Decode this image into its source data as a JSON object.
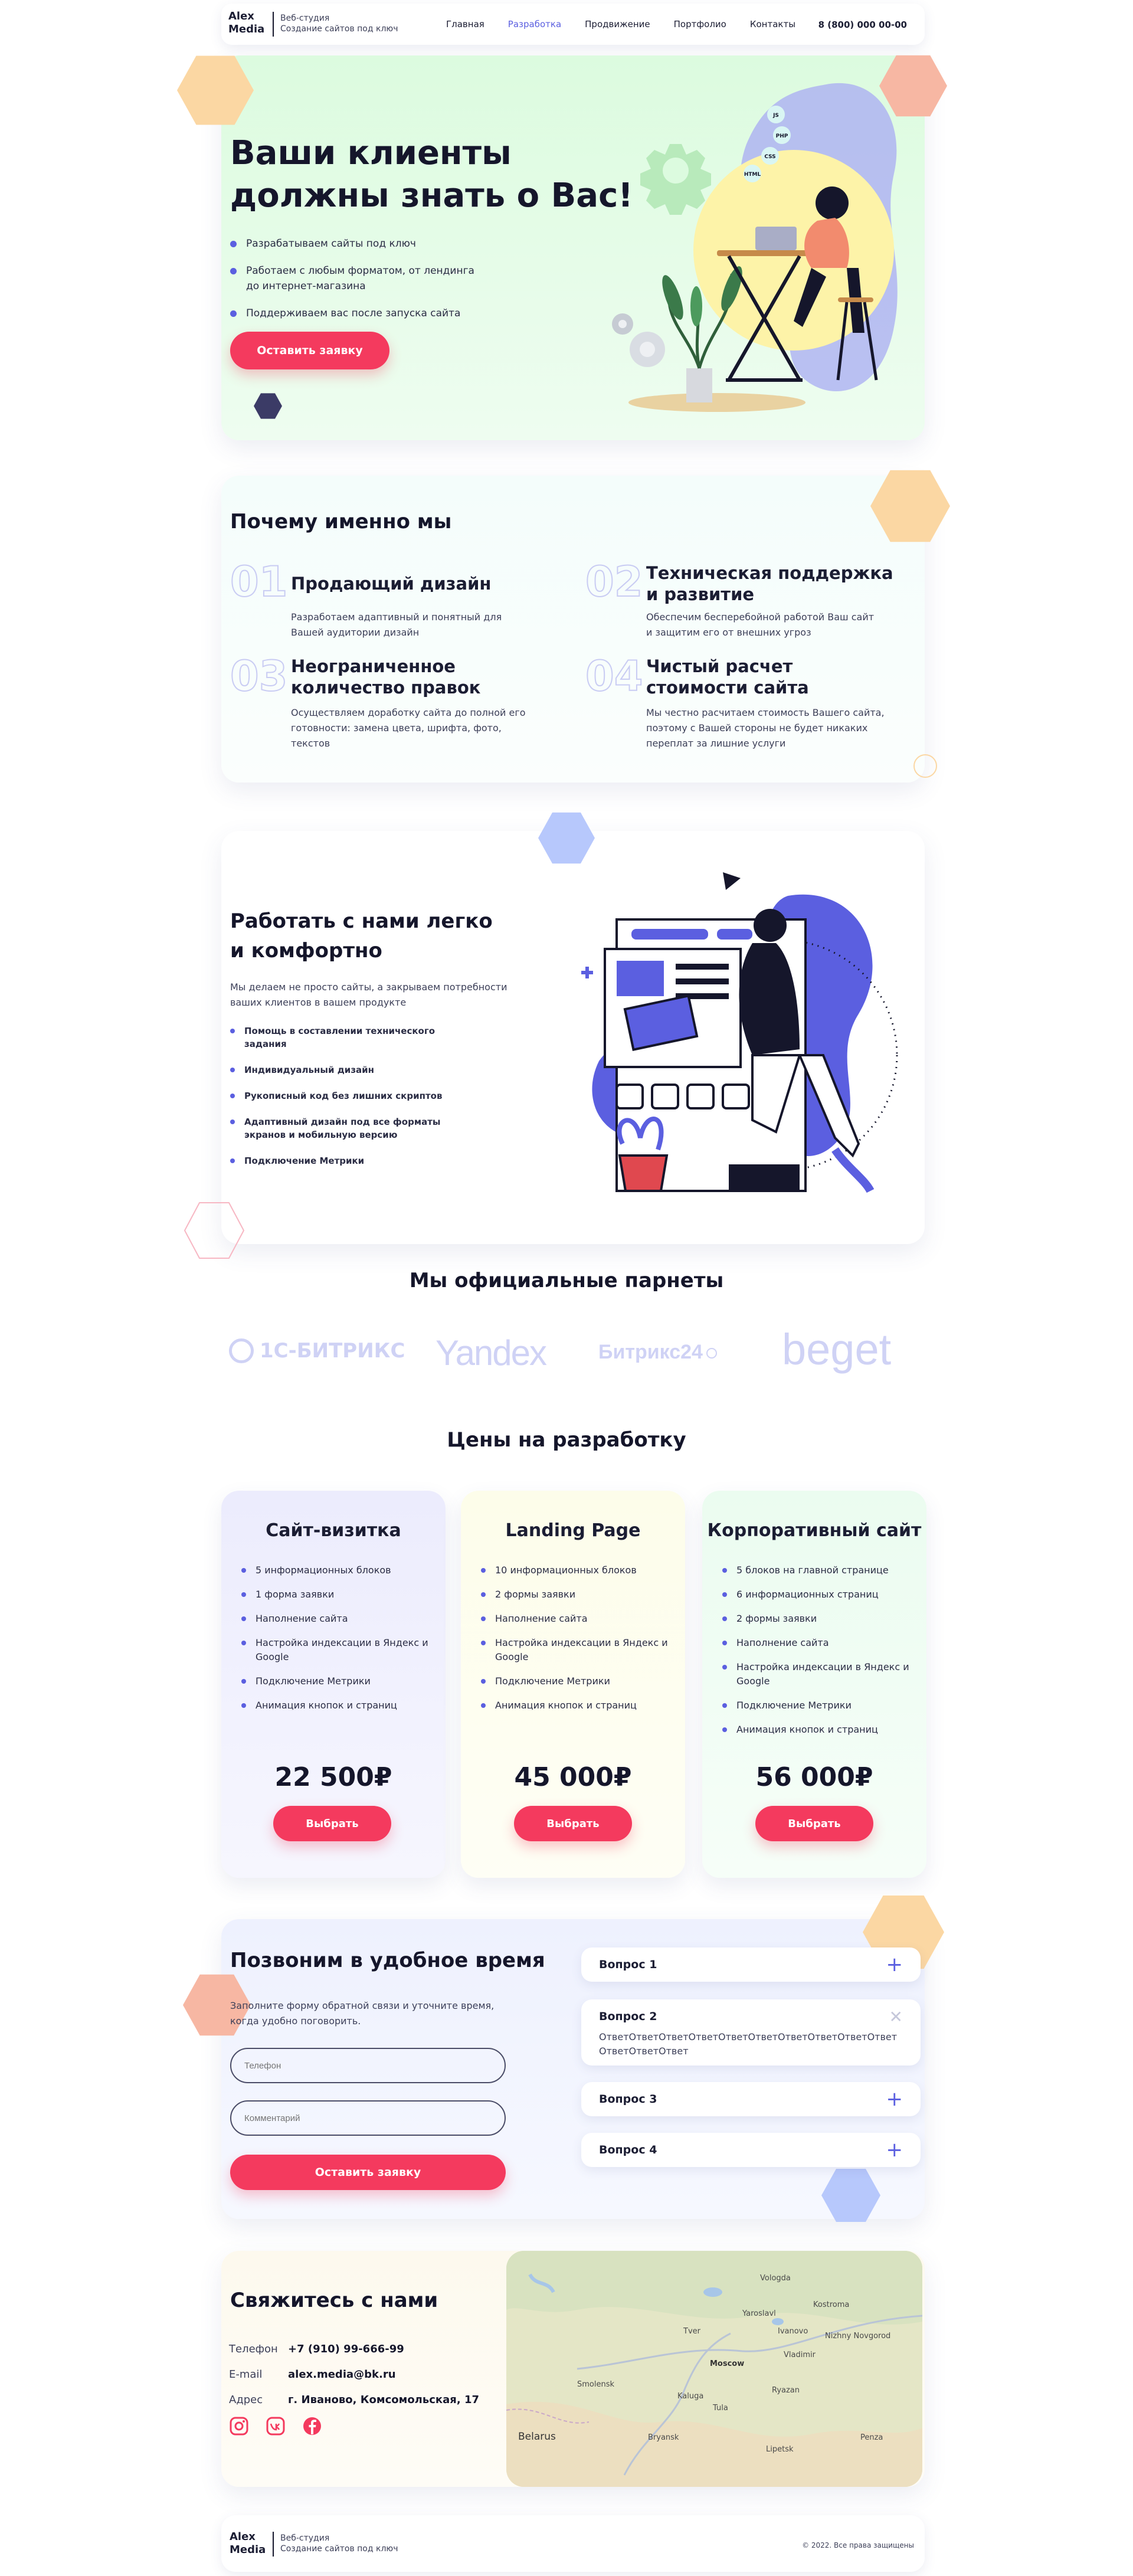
{
  "header": {
    "logo": [
      "Alex",
      "Media"
    ],
    "tagline": [
      "Веб-студия",
      "Создание сайтов под ключ"
    ],
    "nav": [
      "Главная",
      "Разработка",
      "Продвижение",
      "Портфолио",
      "Контакты"
    ],
    "phone": "8 (800) 000 00-00"
  },
  "hero": {
    "title_line1": "Ваши клиенты",
    "title_line2": "должны знать о Вас!",
    "bullets": [
      "Разрабатываем сайты под ключ",
      "Работаем с любым форматом, от лендинга до интернет-магазина",
      "Поддерживаем вас после запуска сайта"
    ],
    "cta": "Оставить заявку",
    "bubble_labels": [
      "JS",
      "PHP",
      "CSS",
      "HTML"
    ]
  },
  "why": {
    "title": "Почему именно мы",
    "items": [
      {
        "num": "01",
        "title": "Продающий дизайн",
        "text": "Разработаем адаптивный и понятный для Вашей аудитории дизайн"
      },
      {
        "num": "02",
        "title": "Техническая поддержка и развитие",
        "text": "Обеспечим бесперебойной работой Ваш сайт и защитим его от внешних угроз"
      },
      {
        "num": "03",
        "title": "Неограниченное количество правок",
        "text": "Осуществляем доработку сайта до полной его готовности: замена цвета, шрифта, фото, текстов"
      },
      {
        "num": "04",
        "title": "Чистый расчет стоимости сайта",
        "text": "Мы честно расчитаем стоимость Вашего сайта, поэтому с Вашей стороны не будет никаких переплат за лишние услуги"
      }
    ]
  },
  "easy": {
    "title_line1": "Работать с нами легко",
    "title_line2": "и комфортно",
    "text": "Мы делаем не просто сайты, а закрываем потребности ваших клиентов в вашем продукте",
    "bullets": [
      "Помощь в составлении технического задания",
      "Индивидуальный дизайн",
      "Рукописный код без лишних скриптов",
      "Адаптивный дизайн под все форматы экранов и мобильную версию",
      "Подключение Метрики"
    ]
  },
  "partners": {
    "title": "Мы официальные парнеты",
    "logos": [
      "1С-БИТРИКС",
      "Yandex",
      "Битрикс24",
      "beget"
    ]
  },
  "pricing": {
    "title": "Цены на разработку",
    "plans": [
      {
        "name": "Сайт-визитка",
        "features": [
          "5 информационных блоков",
          "1 форма заявки",
          "Наполнение сайта",
          "Настройка индексации в Яндекс и Google",
          "Подключение Метрики",
          "Анимация кнопок и страниц"
        ],
        "price": "22 500₽",
        "button": "Выбрать"
      },
      {
        "name": "Landing Page",
        "features": [
          "10 информационных блоков",
          "2 формы заявки",
          "Наполнение сайта",
          "Настройка индексации в Яндекс и Google",
          "Подключение Метрики",
          "Анимация кнопок и страниц"
        ],
        "price": "45 000₽",
        "button": "Выбрать"
      },
      {
        "name": "Корпоративный сайт",
        "features": [
          "5 блоков на главной странице",
          "6 информационных страниц",
          "2 формы заявки",
          "Наполнение сайта",
          "Настройка индексации в Яндекс и Google",
          "Подключение Метрики",
          "Анимация кнопок и страниц"
        ],
        "price": "56 000₽",
        "button": "Выбрать"
      }
    ]
  },
  "callback": {
    "title": "Позвоним в удобное время",
    "text": "Заполните форму обратной связи и уточните время, когда удобно поговорить.",
    "phone_placeholder": "Телефон",
    "comment_placeholder": "Комментарий",
    "cta": "Оставить заявку",
    "faq": [
      {
        "q": "Вопрос 1",
        "a": ""
      },
      {
        "q": "Вопрос 2",
        "a": "ОтветОтветОтветОтветОтветОтветОтветОтветОтветОтветОтветОтветОтвет"
      },
      {
        "q": "Вопрос 3",
        "a": ""
      },
      {
        "q": "Вопрос 4",
        "a": ""
      }
    ]
  },
  "contacts": {
    "title": "Свяжитесь с нами",
    "rows": [
      {
        "label": "Телефон",
        "value": "+7 (910) 99-666-99"
      },
      {
        "label": "E-mail",
        "value": "alex.media@bk.ru"
      },
      {
        "label": "Адрес",
        "value": "г. Иваново, Комсомольская, 17"
      }
    ],
    "map_labels": [
      "Belarus",
      "Moscow",
      "Nizhny Novgorod",
      "Yaroslavl",
      "Ivanovo",
      "Tver",
      "Vologda",
      "Smolensk",
      "Kaluga",
      "Tula",
      "Ryazan",
      "Vladimir",
      "Kostroma",
      "Bryansk",
      "Lipetsk",
      "Penza"
    ]
  },
  "footer": {
    "logo": [
      "Alex",
      "Media"
    ],
    "tagline": [
      "Веб-студия",
      "Создание сайтов под ключ"
    ],
    "copyright": "© 2022. Все права защищены"
  },
  "colors": {
    "accent": "#5b5fe0",
    "cta": "#f43a5e",
    "dark": "#15162b"
  }
}
